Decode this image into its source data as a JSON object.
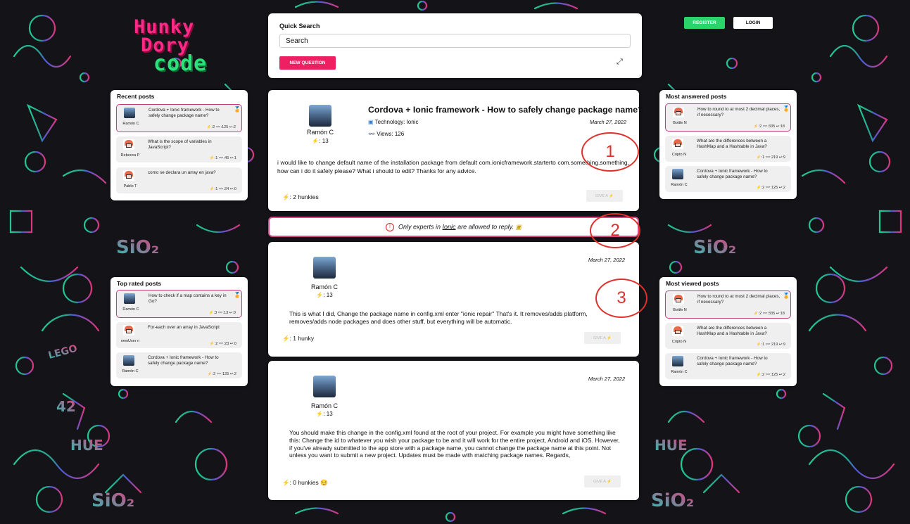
{
  "logo": {
    "line1": "Hunky",
    "line2": "Dory",
    "line3": "code"
  },
  "auth": {
    "register": "REGISTER",
    "login": "LOGIN"
  },
  "quick_search": {
    "title": "Quick Search",
    "placeholder": "Search",
    "new_question": "NEW QUESTION"
  },
  "recent_posts": {
    "title": "Recent posts",
    "items": [
      {
        "user": "Ramón C",
        "title": "Cordova + Ionic framework - How to safely change package name?",
        "stats": "⚡:2  👓:125  ↩:2",
        "avatar": "ramon"
      },
      {
        "user": "Rebecca P",
        "title": "What is the scope of variables in JavaScript?",
        "stats": "⚡:1  👓:45  ↩:1",
        "avatar": "robot"
      },
      {
        "user": "Pablo T",
        "title": "como se declara un array en java?",
        "stats": "⚡:1  👓:24  ↩:0",
        "avatar": "robot"
      }
    ]
  },
  "top_rated": {
    "title": "Top rated posts",
    "items": [
      {
        "user": "Ramón C",
        "title": "How to check if a map contains a key in Go?",
        "stats": "⚡:3  👓:13  ↩:0",
        "avatar": "ramon"
      },
      {
        "user": "newUser n",
        "title": "For-each over an array in JavaScript",
        "stats": "⚡:2  👓:23  ↩:0",
        "avatar": "robot"
      },
      {
        "user": "Ramón C",
        "title": "Cordova + Ionic framework - How to safely change package name?",
        "stats": "⚡:2  👓:125  ↩:2",
        "avatar": "ramon"
      }
    ]
  },
  "most_answered": {
    "title": "Most answered posts",
    "items": [
      {
        "user": "Bottle N",
        "title": "How to round to at most 2 decimal places, if necessary?",
        "stats": "⚡:2  👓:335  ↩:18",
        "avatar": "robot"
      },
      {
        "user": "Cripto N",
        "title": "What are the differences between a HashMap and a Hashtable in Java?",
        "stats": "⚡:1  👓:219  ↩:9",
        "avatar": "robot"
      },
      {
        "user": "Ramón C",
        "title": "Cordova + Ionic framework - How to safely change package name?",
        "stats": "⚡:2  👓:125  ↩:2",
        "avatar": "ramon"
      }
    ]
  },
  "most_viewed": {
    "title": "Most viewed posts",
    "items": [
      {
        "user": "Bottle N",
        "title": "How to round to at most 2 decimal places, if necessary?",
        "stats": "⚡:2  👓:335  ↩:18",
        "avatar": "robot"
      },
      {
        "user": "Cripto N",
        "title": "What are the differences between a HashMap and a Hashtable in Java?",
        "stats": "⚡:1  👓:219  ↩:9",
        "avatar": "robot"
      },
      {
        "user": "Ramón C",
        "title": "Cordova + Ionic framework - How to safely change package name?",
        "stats": "⚡:2  👓:125  ↩:2",
        "avatar": "ramon"
      }
    ]
  },
  "question": {
    "author": "Ramón C",
    "reputation": "⚡: 13",
    "title": "Cordova + Ionic framework - How to safely change package name?",
    "technology": "Technology: Ionic",
    "views": "Views: 126",
    "date": "March 27, 2022",
    "body": "i would like to change default name of the installation package from default com.ionicframework.starterto com.something.something, how can i do it safely please? What i should to edit? Thanks for any advice.",
    "hunkies": "⚡: 2 hunkies",
    "give": "GIVE A ⚡"
  },
  "notice": {
    "prefix": "Only experts in ",
    "tech": "Ionic",
    "suffix": " are allowed to reply."
  },
  "answers": [
    {
      "author": "Ramón C",
      "reputation": "⚡: 13",
      "date": "March 27, 2022",
      "body": "This is what I did, Change the package name in config.xml enter \"ionic repair\" That's it. It removes/adds platform, removes/adds node packages and does other stuff, but everything will be automatic.",
      "hunkies": "⚡: 1 hunky",
      "give": "GIVE A ⚡"
    },
    {
      "author": "Ramón C",
      "reputation": "⚡: 13",
      "date": "March 27, 2022",
      "body": "You should make this change in the config.xml found at the root of your project. For example you might have something like this: Change the id to whatever you wish your package to be and it will work for the entire project, Android and iOS. However, if you've already submitted to the app store with a package name, you cannot change the package name at this point. Not unless you want to submit a new project. Updates must be made with matching package names. Regards,",
      "hunkies": "⚡: 0 hunkies 😔",
      "give": "GIVE A ⚡"
    }
  ],
  "annotations": [
    "1",
    "2",
    "3"
  ],
  "colors": {
    "accent_pink": "#ef1f64",
    "accent_green": "#2bd46b",
    "annotation_red": "#e0302b"
  },
  "background": {
    "texts": [
      "SiO₂",
      "SiO₂",
      "SiO₂",
      "SiO₂",
      "HUE",
      "HUE",
      "LEGO",
      "42"
    ]
  }
}
